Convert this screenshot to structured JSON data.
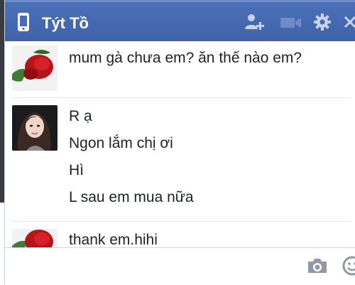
{
  "header": {
    "title": "Týt Tồ",
    "icons": [
      "mobile-phone-icon",
      "add-friend-icon",
      "video-call-icon",
      "gear-icon",
      "close-icon"
    ]
  },
  "messages": {
    "groups": [
      {
        "sender_avatar": "rose-avatar",
        "lines": [
          "mum gà chưa em? ăn thế nào em?"
        ]
      },
      {
        "sender_avatar": "woman-avatar",
        "lines": [
          "R ạ",
          "Ngon lắm chị ơi",
          "Hì",
          "L sau em mua nữa"
        ]
      },
      {
        "sender_avatar": "rose-avatar",
        "lines": [
          "thank em.hihi"
        ]
      }
    ]
  },
  "composer": {
    "placeholder": "",
    "icons": [
      "camera-icon",
      "emoji-icon"
    ]
  },
  "colors": {
    "header_bg": "#4267b2",
    "header_text": "#ffffff",
    "message_text": "#1d2129",
    "icon_gray": "#9197a3"
  }
}
